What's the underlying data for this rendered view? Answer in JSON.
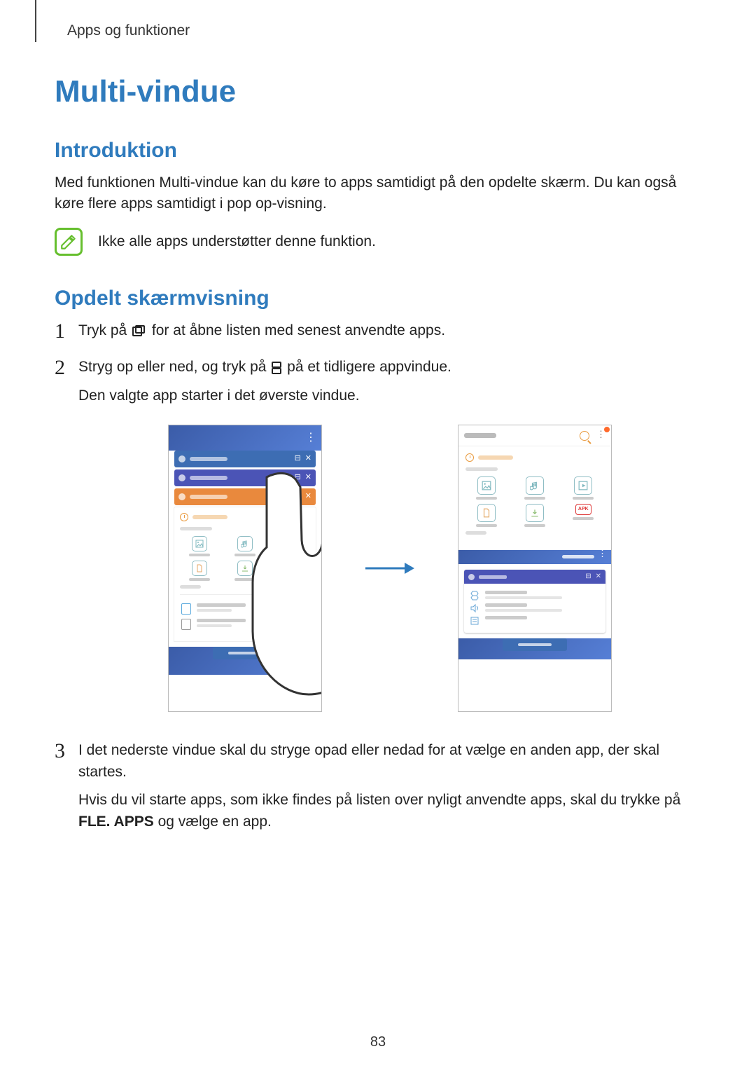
{
  "breadcrumb": "Apps og funktioner",
  "title": "Multi-vindue",
  "section_intro": "Introduktion",
  "intro_text": "Med funktionen Multi-vindue kan du køre to apps samtidigt på den opdelte skærm. Du kan også køre flere apps samtidigt i pop op-visning.",
  "note_text": "Ikke alle apps understøtter denne funktion.",
  "section_split": "Opdelt skærmvisning",
  "steps": {
    "s1_a": "Tryk på ",
    "s1_b": " for at åbne listen med senest anvendte apps.",
    "s2_a": "Stryg op eller ned, og tryk på ",
    "s2_b": " på et tidligere appvindue.",
    "s2_c": "Den valgte app starter i det øverste vindue.",
    "s3_a": "I det nederste vindue skal du stryge opad eller nedad for at vælge en anden app, der skal startes.",
    "s3_b": "Hvis du vil starte apps, som ikke findes på listen over nyligt anvendte apps, skal du trykke på ",
    "s3_bold": "FLE. APPS",
    "s3_c": " og vælge en app."
  },
  "numbers": {
    "n1": "1",
    "n2": "2",
    "n3": "3"
  },
  "figure": {
    "apk_label": "APK"
  },
  "page_number": "83"
}
